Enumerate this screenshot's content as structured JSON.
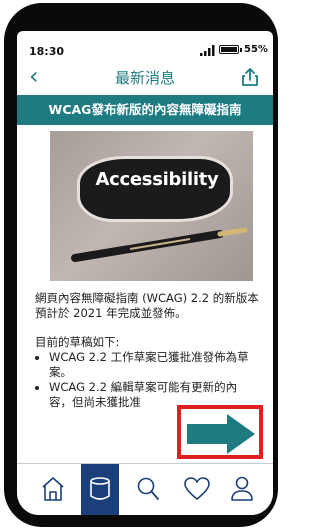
{
  "status_bar": {
    "time": "18:30",
    "battery_percent": "55%"
  },
  "nav": {
    "back_icon": "chevron-left-icon",
    "title": "最新消息",
    "share_icon": "share-icon"
  },
  "article": {
    "banner_title": "WCAG發布新版的內容無障礙指南",
    "image_word": "Accessibility",
    "paragraph1": "網頁內容無障礙指南 (WCAG) 2.2 的新版本預計於 2021 年完成並發佈。",
    "paragraph2": "目前的草稿如下:",
    "bullets": [
      "WCAG 2.2 工作草案已獲批准發佈為草案。",
      "WCAG 2.2 編輯草案可能有更新的內容，但尚未獲批准"
    ]
  },
  "next_arrow": {
    "icon": "arrow-right-icon",
    "color": "#1e7b82",
    "highlight_color": "#e02020"
  },
  "tab_bar": {
    "items": [
      {
        "icon": "home-icon",
        "active": false
      },
      {
        "icon": "database-icon",
        "active": true
      },
      {
        "icon": "search-icon",
        "active": false
      },
      {
        "icon": "heart-icon",
        "active": false
      },
      {
        "icon": "user-icon",
        "active": false
      }
    ],
    "active_color": "#1b3f7a"
  },
  "colors": {
    "accent": "#1e7b82"
  }
}
